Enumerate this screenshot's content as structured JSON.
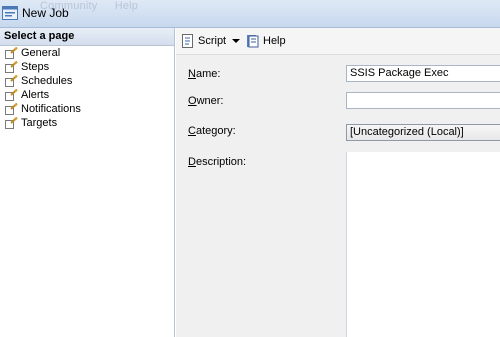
{
  "window": {
    "title": "New Job",
    "ghost_menu": [
      "Community",
      "Help"
    ]
  },
  "sidebar": {
    "header": "Select a page",
    "items": [
      {
        "label": "General",
        "icon": "page-wrench-icon"
      },
      {
        "label": "Steps",
        "icon": "page-wrench-icon"
      },
      {
        "label": "Schedules",
        "icon": "page-wrench-icon"
      },
      {
        "label": "Alerts",
        "icon": "page-wrench-icon"
      },
      {
        "label": "Notifications",
        "icon": "page-wrench-icon"
      },
      {
        "label": "Targets",
        "icon": "page-wrench-icon"
      }
    ]
  },
  "toolbar": {
    "script_label": "Script",
    "help_label": "Help"
  },
  "form": {
    "name_label_first": "N",
    "name_label_rest": "ame:",
    "name_value": "SSIS Package Exec",
    "owner_label_first": "O",
    "owner_label_rest": "wner:",
    "owner_value": "",
    "category_label_first": "C",
    "category_label_rest": "ategory:",
    "category_value": "[Uncategorized (Local)]",
    "description_label_first": "D",
    "description_label_rest": "escription:",
    "description_value": ""
  },
  "colors": {
    "titlebar": "#c7d8ee",
    "main_bg": "#f0f0f0",
    "field_border": "#a9b6c6"
  }
}
